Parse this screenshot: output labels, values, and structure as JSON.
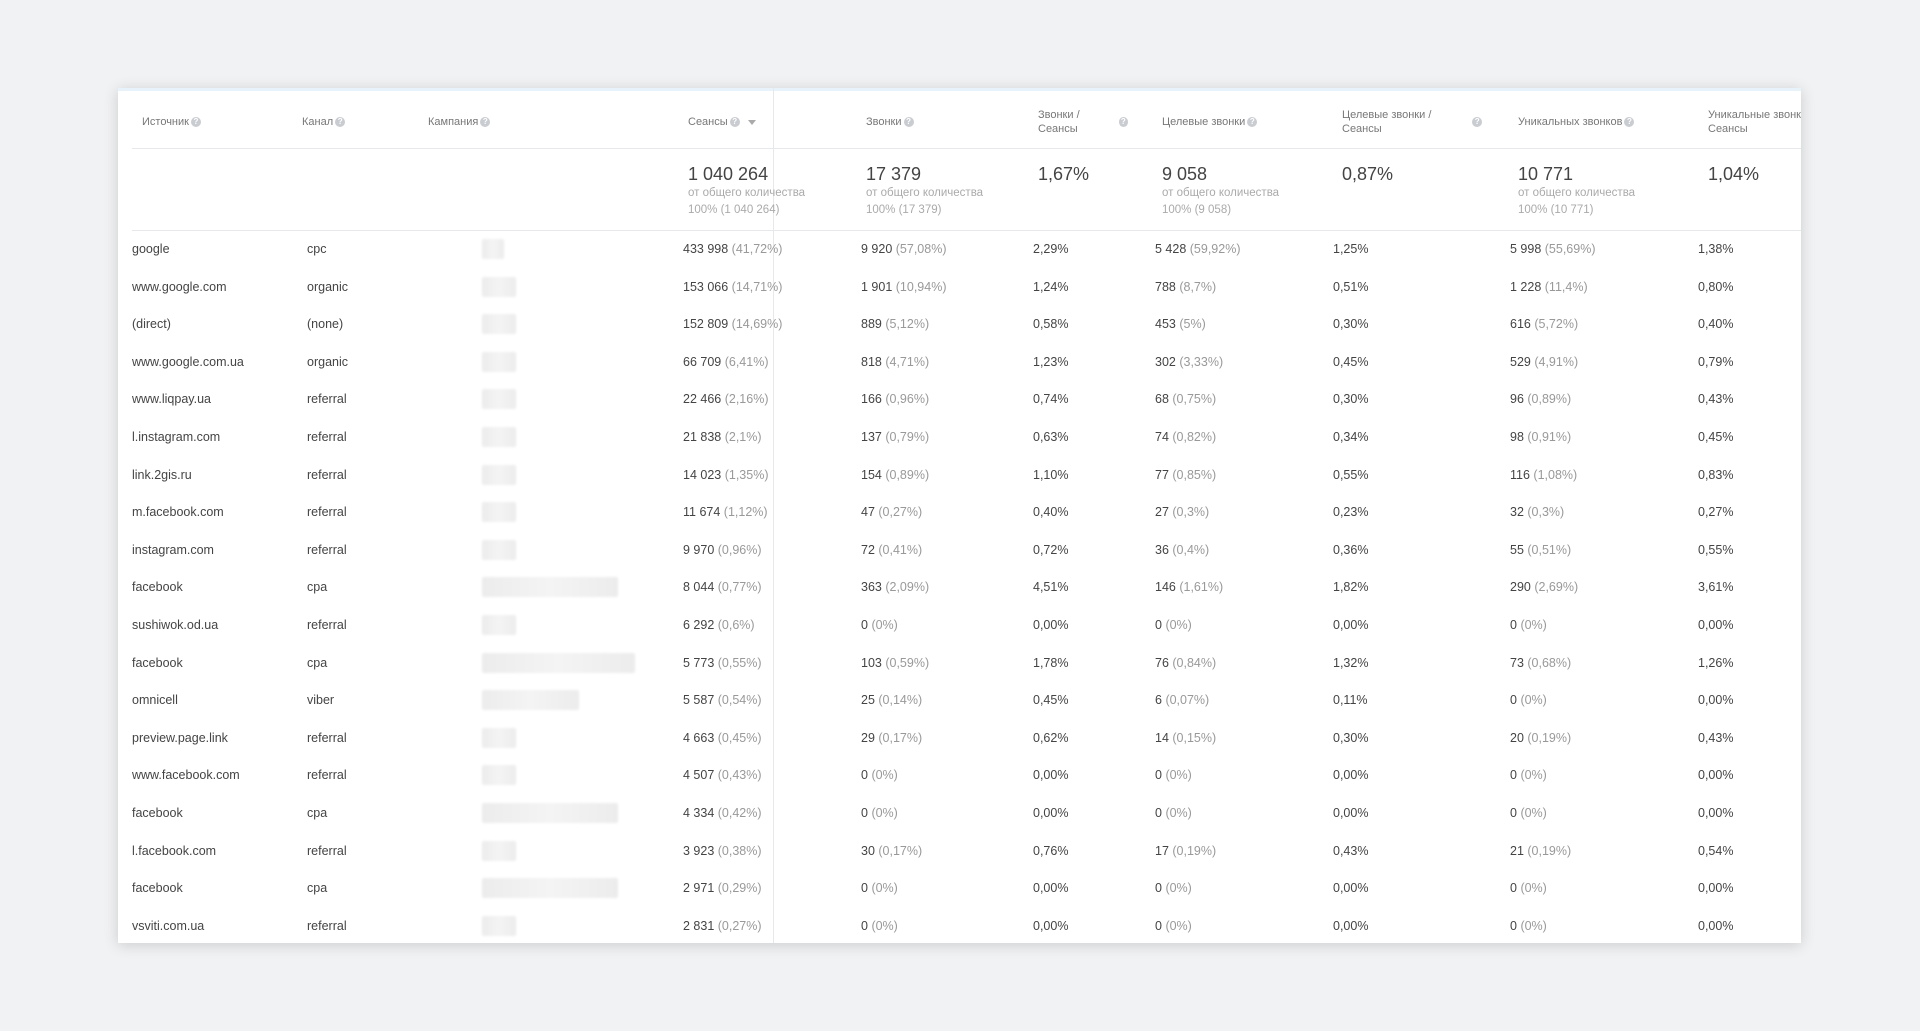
{
  "columns": [
    {
      "label": "Источник",
      "help": true
    },
    {
      "label": "Канал",
      "help": true
    },
    {
      "label": "Кампания",
      "help": true
    },
    {
      "label": "Сеансы",
      "help": true,
      "sort": true
    },
    {
      "label": "Звонки",
      "help": true
    },
    {
      "label": "Звонки / Сеансы",
      "help": true
    },
    {
      "label": "Целевые звонки",
      "help": true
    },
    {
      "label": "Целевые звонки / Сеансы",
      "help": true
    },
    {
      "label": "Уникальных звонков",
      "help": true
    },
    {
      "label": "Уникальные звонки / Сеансы",
      "help": false
    }
  ],
  "totals": [
    {
      "value": "1 040 264",
      "sub1": "от общего количества",
      "sub2": "100% (1 040 264)"
    },
    {
      "value": "17 379",
      "sub1": "от общего количества",
      "sub2": "100% (17 379)"
    },
    {
      "value": "1,67%",
      "sub1": "",
      "sub2": ""
    },
    {
      "value": "9 058",
      "sub1": "от общего количества",
      "sub2": "100% (9 058)"
    },
    {
      "value": "0,87%",
      "sub1": "",
      "sub2": ""
    },
    {
      "value": "10 771",
      "sub1": "от общего количества",
      "sub2": "100% (10 771)"
    },
    {
      "value": "1,04%",
      "sub1": "",
      "sub2": ""
    }
  ],
  "rows": [
    {
      "source": "google",
      "channel": "cpc",
      "sessions": "433 998",
      "sessions_pct": "(41,72%)",
      "calls": "9 920",
      "calls_pct": "(57,08%)",
      "calls_rate": "2,29%",
      "target": "5 428",
      "target_pct": "(59,92%)",
      "target_rate": "1,25%",
      "unique": "5 998",
      "unique_pct": "(55,69%)",
      "unique_rate": "1,38%",
      "campaign_bar": 0.13
    },
    {
      "source": "www.google.com",
      "channel": "organic",
      "sessions": "153 066",
      "sessions_pct": "(14,71%)",
      "calls": "1 901",
      "calls_pct": "(10,94%)",
      "calls_rate": "1,24%",
      "target": "788",
      "target_pct": "(8,7%)",
      "target_rate": "0,51%",
      "unique": "1 228",
      "unique_pct": "(11,4%)",
      "unique_rate": "0,80%",
      "campaign_bar": 0.2
    },
    {
      "source": "(direct)",
      "channel": "(none)",
      "sessions": "152 809",
      "sessions_pct": "(14,69%)",
      "calls": "889",
      "calls_pct": "(5,12%)",
      "calls_rate": "0,58%",
      "target": "453",
      "target_pct": "(5%)",
      "target_rate": "0,30%",
      "unique": "616",
      "unique_pct": "(5,72%)",
      "unique_rate": "0,40%",
      "campaign_bar": 0.2
    },
    {
      "source": "www.google.com.ua",
      "channel": "organic",
      "sessions": "66 709",
      "sessions_pct": "(6,41%)",
      "calls": "818",
      "calls_pct": "(4,71%)",
      "calls_rate": "1,23%",
      "target": "302",
      "target_pct": "(3,33%)",
      "target_rate": "0,45%",
      "unique": "529",
      "unique_pct": "(4,91%)",
      "unique_rate": "0,79%",
      "campaign_bar": 0.2
    },
    {
      "source": "www.liqpay.ua",
      "channel": "referral",
      "sessions": "22 466",
      "sessions_pct": "(2,16%)",
      "calls": "166",
      "calls_pct": "(0,96%)",
      "calls_rate": "0,74%",
      "target": "68",
      "target_pct": "(0,75%)",
      "target_rate": "0,30%",
      "unique": "96",
      "unique_pct": "(0,89%)",
      "unique_rate": "0,43%",
      "campaign_bar": 0.2
    },
    {
      "source": "l.instagram.com",
      "channel": "referral",
      "sessions": "21 838",
      "sessions_pct": "(2,1%)",
      "calls": "137",
      "calls_pct": "(0,79%)",
      "calls_rate": "0,63%",
      "target": "74",
      "target_pct": "(0,82%)",
      "target_rate": "0,34%",
      "unique": "98",
      "unique_pct": "(0,91%)",
      "unique_rate": "0,45%",
      "campaign_bar": 0.2
    },
    {
      "source": "link.2gis.ru",
      "channel": "referral",
      "sessions": "14 023",
      "sessions_pct": "(1,35%)",
      "calls": "154",
      "calls_pct": "(0,89%)",
      "calls_rate": "1,10%",
      "target": "77",
      "target_pct": "(0,85%)",
      "target_rate": "0,55%",
      "unique": "116",
      "unique_pct": "(1,08%)",
      "unique_rate": "0,83%",
      "campaign_bar": 0.2
    },
    {
      "source": "m.facebook.com",
      "channel": "referral",
      "sessions": "11 674",
      "sessions_pct": "(1,12%)",
      "calls": "47",
      "calls_pct": "(0,27%)",
      "calls_rate": "0,40%",
      "target": "27",
      "target_pct": "(0,3%)",
      "target_rate": "0,23%",
      "unique": "32",
      "unique_pct": "(0,3%)",
      "unique_rate": "0,27%",
      "campaign_bar": 0.2
    },
    {
      "source": "instagram.com",
      "channel": "referral",
      "sessions": "9 970",
      "sessions_pct": "(0,96%)",
      "calls": "72",
      "calls_pct": "(0,41%)",
      "calls_rate": "0,72%",
      "target": "36",
      "target_pct": "(0,4%)",
      "target_rate": "0,36%",
      "unique": "55",
      "unique_pct": "(0,51%)",
      "unique_rate": "0,55%",
      "campaign_bar": 0.2
    },
    {
      "source": "facebook",
      "channel": "cpa",
      "sessions": "8 044",
      "sessions_pct": "(0,77%)",
      "calls": "363",
      "calls_pct": "(2,09%)",
      "calls_rate": "4,51%",
      "target": "146",
      "target_pct": "(1,61%)",
      "target_rate": "1,82%",
      "unique": "290",
      "unique_pct": "(2,69%)",
      "unique_rate": "3,61%",
      "campaign_bar": 0.8
    },
    {
      "source": "sushiwok.od.ua",
      "channel": "referral",
      "sessions": "6 292",
      "sessions_pct": "(0,6%)",
      "calls": "0",
      "calls_pct": "(0%)",
      "calls_rate": "0,00%",
      "target": "0",
      "target_pct": "(0%)",
      "target_rate": "0,00%",
      "unique": "0",
      "unique_pct": "(0%)",
      "unique_rate": "0,00%",
      "campaign_bar": 0.2
    },
    {
      "source": "facebook",
      "channel": "cpa",
      "sessions": "5 773",
      "sessions_pct": "(0,55%)",
      "calls": "103",
      "calls_pct": "(0,59%)",
      "calls_rate": "1,78%",
      "target": "76",
      "target_pct": "(0,84%)",
      "target_rate": "1,32%",
      "unique": "73",
      "unique_pct": "(0,68%)",
      "unique_rate": "1,26%",
      "campaign_bar": 0.9
    },
    {
      "source": "omnicell",
      "channel": "viber",
      "sessions": "5 587",
      "sessions_pct": "(0,54%)",
      "calls": "25",
      "calls_pct": "(0,14%)",
      "calls_rate": "0,45%",
      "target": "6",
      "target_pct": "(0,07%)",
      "target_rate": "0,11%",
      "unique": "0",
      "unique_pct": "(0%)",
      "unique_rate": "0,00%",
      "campaign_bar": 0.57
    },
    {
      "source": "preview.page.link",
      "channel": "referral",
      "sessions": "4 663",
      "sessions_pct": "(0,45%)",
      "calls": "29",
      "calls_pct": "(0,17%)",
      "calls_rate": "0,62%",
      "target": "14",
      "target_pct": "(0,15%)",
      "target_rate": "0,30%",
      "unique": "20",
      "unique_pct": "(0,19%)",
      "unique_rate": "0,43%",
      "campaign_bar": 0.2
    },
    {
      "source": "www.facebook.com",
      "channel": "referral",
      "sessions": "4 507",
      "sessions_pct": "(0,43%)",
      "calls": "0",
      "calls_pct": "(0%)",
      "calls_rate": "0,00%",
      "target": "0",
      "target_pct": "(0%)",
      "target_rate": "0,00%",
      "unique": "0",
      "unique_pct": "(0%)",
      "unique_rate": "0,00%",
      "campaign_bar": 0.2
    },
    {
      "source": "facebook",
      "channel": "cpa",
      "sessions": "4 334",
      "sessions_pct": "(0,42%)",
      "calls": "0",
      "calls_pct": "(0%)",
      "calls_rate": "0,00%",
      "target": "0",
      "target_pct": "(0%)",
      "target_rate": "0,00%",
      "unique": "0",
      "unique_pct": "(0%)",
      "unique_rate": "0,00%",
      "campaign_bar": 0.8
    },
    {
      "source": "l.facebook.com",
      "channel": "referral",
      "sessions": "3 923",
      "sessions_pct": "(0,38%)",
      "calls": "30",
      "calls_pct": "(0,17%)",
      "calls_rate": "0,76%",
      "target": "17",
      "target_pct": "(0,19%)",
      "target_rate": "0,43%",
      "unique": "21",
      "unique_pct": "(0,19%)",
      "unique_rate": "0,54%",
      "campaign_bar": 0.2
    },
    {
      "source": "facebook",
      "channel": "cpa",
      "sessions": "2 971",
      "sessions_pct": "(0,29%)",
      "calls": "0",
      "calls_pct": "(0%)",
      "calls_rate": "0,00%",
      "target": "0",
      "target_pct": "(0%)",
      "target_rate": "0,00%",
      "unique": "0",
      "unique_pct": "(0%)",
      "unique_rate": "0,00%",
      "campaign_bar": 0.8
    },
    {
      "source": "vsviti.com.ua",
      "channel": "referral",
      "sessions": "2 831",
      "sessions_pct": "(0,27%)",
      "calls": "0",
      "calls_pct": "(0%)",
      "calls_rate": "0,00%",
      "target": "0",
      "target_pct": "(0%)",
      "target_rate": "0,00%",
      "unique": "0",
      "unique_pct": "(0%)",
      "unique_rate": "0,00%",
      "campaign_bar": 0.2
    }
  ],
  "colors": {
    "background": "#f1f2f4",
    "card": "#ffffff",
    "muted": "#999999",
    "text": "#444444",
    "border": "#e6e8eb"
  }
}
